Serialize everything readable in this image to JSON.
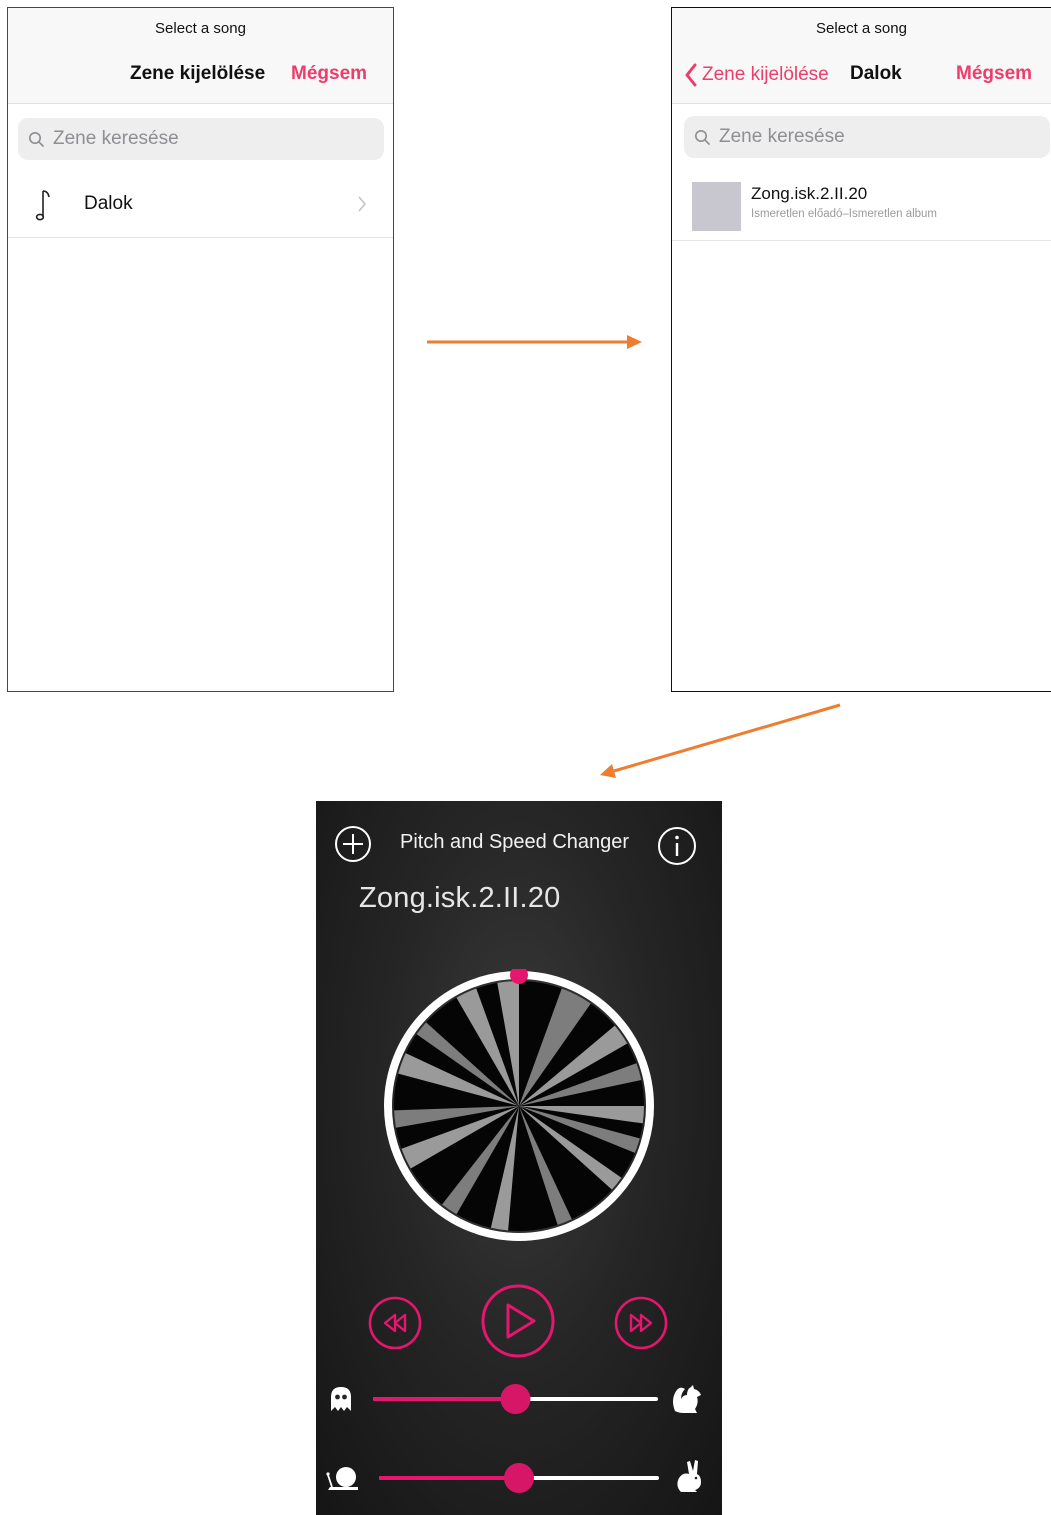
{
  "screen1": {
    "header_subtitle": "Select a song",
    "title": "Zene kijelölése",
    "cancel": "Mégsem",
    "search_placeholder": "Zene keresése",
    "list": [
      {
        "label": "Dalok",
        "icon": "music-note-icon"
      }
    ]
  },
  "screen2": {
    "header_subtitle": "Select a song",
    "back_label": "Zene kijelölése",
    "title": "Dalok",
    "cancel": "Mégsem",
    "search_placeholder": "Zene keresése",
    "songs": [
      {
        "title": "Zong.isk.2.II.20",
        "subtitle": "Ismeretlen előadó–Ismeretlen album"
      }
    ]
  },
  "player": {
    "app_title": "Pitch and Speed Changer",
    "song_title": "Zong.isk.2.II.20",
    "playback_progress": 0.0,
    "pitch_level": 0.5,
    "speed_level": 0.5,
    "icons": {
      "add": "plus-circle-icon",
      "info": "info-icon",
      "rewind": "rewind-icon",
      "play": "play-icon",
      "forward": "fast-forward-icon",
      "pitch_low": "ghost-icon",
      "pitch_high": "squirrel-icon",
      "speed_low": "snail-icon",
      "speed_high": "rabbit-icon"
    }
  },
  "colors": {
    "ios_accent": "#ec3d6b",
    "player_accent": "#e6166f",
    "arrow": "#ed7d31",
    "player_bg": "#262626"
  }
}
